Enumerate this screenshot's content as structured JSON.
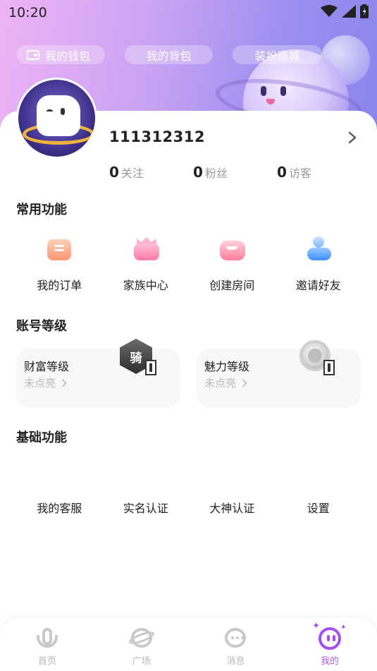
{
  "status_bar": {
    "time": "10:20"
  },
  "header_chips": [
    {
      "label": "我的钱包"
    },
    {
      "label": "我的背包"
    },
    {
      "label": "装扮商城"
    }
  ],
  "profile": {
    "username": "111312312",
    "stats": [
      {
        "value": "0",
        "label": "关注"
      },
      {
        "value": "0",
        "label": "粉丝"
      },
      {
        "value": "0",
        "label": "访客"
      }
    ]
  },
  "common_functions": {
    "title": "常用功能",
    "items": [
      {
        "label": "我的订单",
        "icon": "order-icon"
      },
      {
        "label": "家族中心",
        "icon": "family-crown-icon"
      },
      {
        "label": "创建房间",
        "icon": "create-room-icon"
      },
      {
        "label": "邀请好友",
        "icon": "invite-friend-icon"
      }
    ]
  },
  "account_level": {
    "title": "账号等级",
    "cards": [
      {
        "title": "财富等级",
        "status": "未点亮",
        "badge_text": "骑"
      },
      {
        "title": "魅力等级",
        "status": "未点亮"
      }
    ]
  },
  "basic_functions": {
    "title": "基础功能",
    "items": [
      {
        "label": "我的客服"
      },
      {
        "label": "实名认证"
      },
      {
        "label": "大神认证"
      },
      {
        "label": "设置"
      }
    ]
  },
  "tab_bar": {
    "active_color": "#b65bf0",
    "tabs": [
      {
        "label": "首页"
      },
      {
        "label": "广场"
      },
      {
        "label": "消息"
      },
      {
        "label": "我的"
      }
    ]
  }
}
